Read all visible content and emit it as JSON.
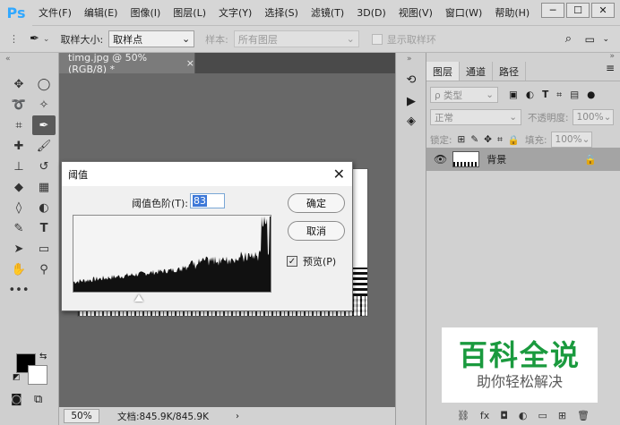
{
  "app": {
    "logo": "Ps"
  },
  "menu": [
    "文件(F)",
    "编辑(E)",
    "图像(I)",
    "图层(L)",
    "文字(Y)",
    "选择(S)",
    "滤镜(T)",
    "3D(D)",
    "视图(V)",
    "窗口(W)",
    "帮助(H)"
  ],
  "window_controls": [
    "─",
    "☐",
    "✕"
  ],
  "options_bar": {
    "sample_size_label": "取样大小:",
    "sample_size_value": "取样点",
    "sample_label": "样本:",
    "sample_value": "所有图层",
    "show_ring_label": "显示取样环"
  },
  "document": {
    "tab_title": "timg.jpg @ 50%(RGB/8) *",
    "zoom": "50%",
    "doc_info": "文档:845.9K/845.9K"
  },
  "threshold_dialog": {
    "title": "阈值",
    "level_label": "阈值色阶(T):",
    "level_value": "83",
    "ok_label": "确定",
    "cancel_label": "取消",
    "preview_label": "预览(P)",
    "preview_checked": "✓",
    "threshold_fraction": 0.33
  },
  "layers_panel": {
    "tabs": [
      "图层",
      "通道",
      "路径"
    ],
    "kind_filter": "ρ 类型",
    "blend_mode": "正常",
    "opacity_label": "不透明度:",
    "opacity_value": "100%",
    "lock_label": "锁定:",
    "fill_label": "填充:",
    "fill_value": "100%",
    "layer_name": "背景"
  },
  "watermark": {
    "title": "百科全说",
    "subtitle": "助你轻松解决"
  },
  "colors": {
    "accent": "#31a8ff",
    "watermark_green": "#1a9a3e",
    "selection_blue": "#3d78d8"
  }
}
